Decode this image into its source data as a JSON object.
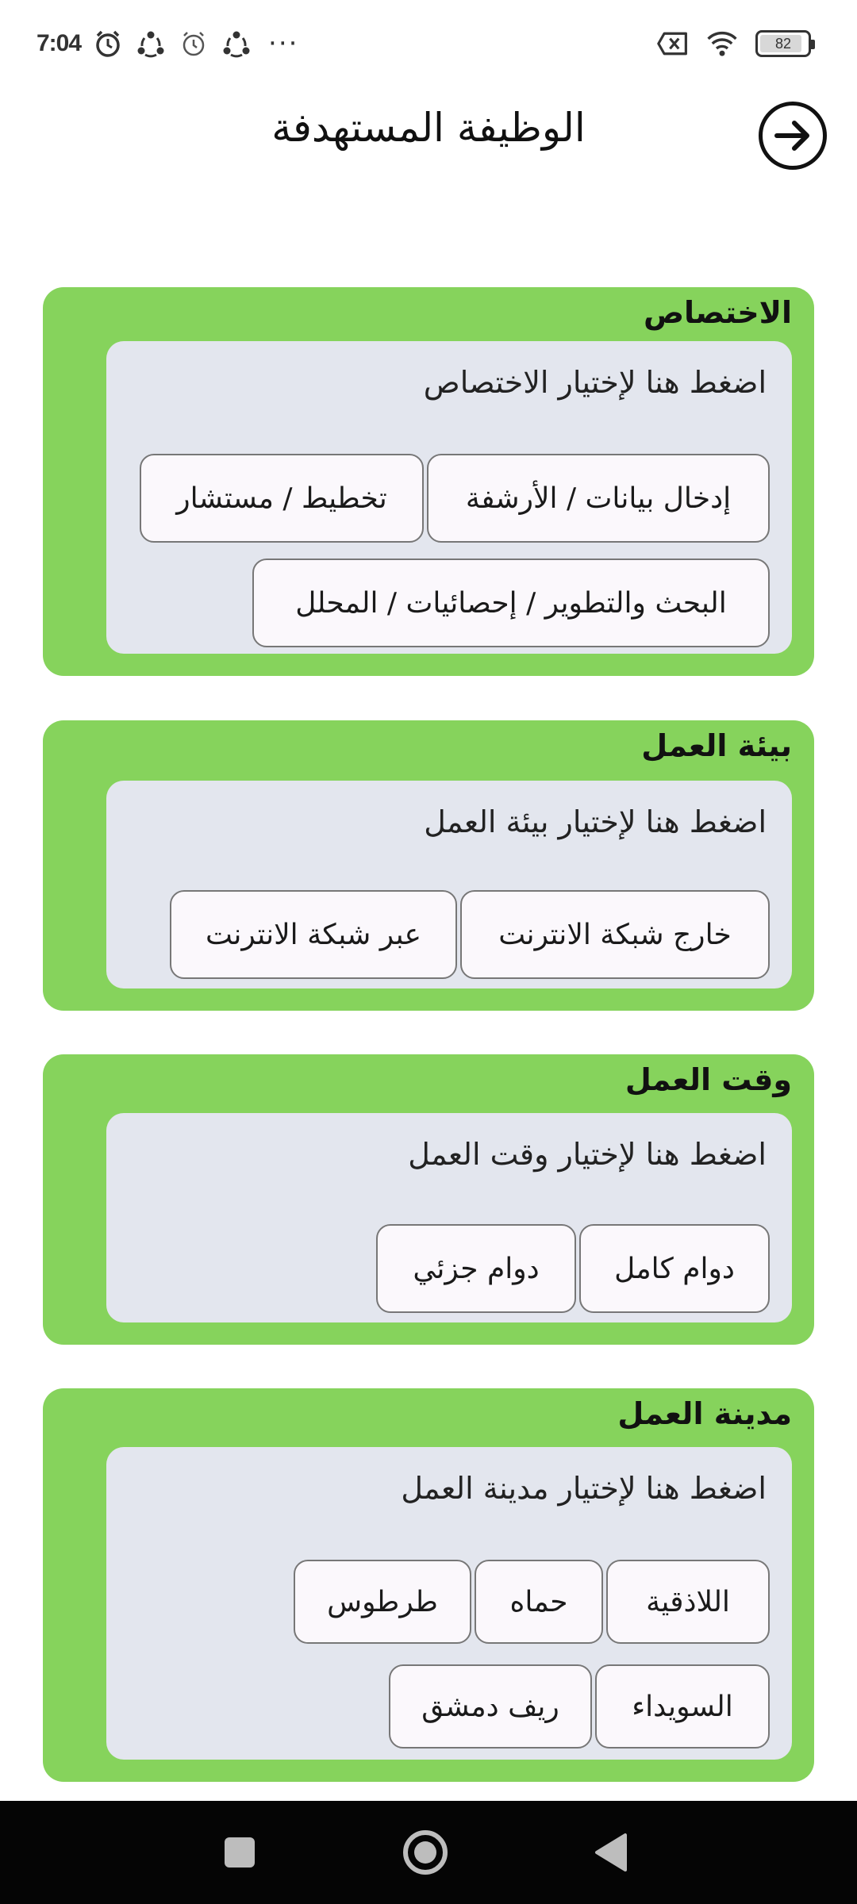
{
  "status_bar": {
    "time": "7:04",
    "icons": [
      "heart-icon",
      "alarm-icon",
      "sync-icon",
      "alarm-outline-icon",
      "sync-icon"
    ],
    "more": "···",
    "battery_level": "82"
  },
  "header": {
    "title": "الوظيفة المستهدفة",
    "back_icon": "arrow-right-circle-icon"
  },
  "sections": [
    {
      "title": "الاختصاص",
      "prompt": "اضغط هنا لإختيار الاختصاص",
      "options": [
        "إدخال بيانات / الأرشفة",
        "تخطيط / مستشار",
        "البحث والتطوير / إحصائيات / المحلل"
      ]
    },
    {
      "title": "بيئة العمل",
      "prompt": "اضغط هنا لإختيار بيئة العمل",
      "options": [
        "خارج شبكة الانترنت",
        "عبر شبكة الانترنت"
      ]
    },
    {
      "title": "وقت العمل",
      "prompt": "اضغط هنا لإختيار وقت العمل",
      "options": [
        "دوام كامل",
        "دوام جزئي"
      ]
    },
    {
      "title": "مدينة العمل",
      "prompt": "اضغط هنا لإختيار مدينة العمل",
      "options": [
        "اللاذقية",
        "حماه",
        "طرطوس",
        "السويداء",
        "ريف دمشق"
      ]
    }
  ],
  "colors": {
    "section_bg": "#86d35c",
    "panel_bg": "#e3e6ee",
    "chip_bg": "#fbf8fc",
    "nav_bg": "#050505"
  },
  "nav": {
    "recents_icon": "square-icon",
    "home_icon": "circle-home-icon",
    "back_icon": "triangle-back-icon"
  }
}
